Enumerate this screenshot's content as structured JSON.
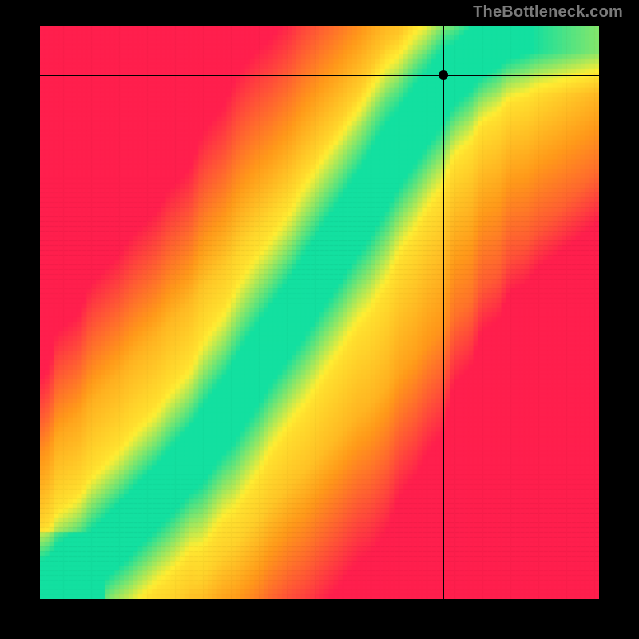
{
  "attribution": "TheBottleneck.com",
  "colors": {
    "red": "#ff1f4d",
    "orange": "#ff9a1a",
    "yellow": "#ffee33",
    "green": "#14e0a0"
  },
  "plot": {
    "crosshair": {
      "x_frac": 0.722,
      "y_frac": 0.087
    },
    "marker": {
      "x_frac": 0.722,
      "y_frac": 0.087
    },
    "ridge": {
      "comment": "Fractional (x,y) points along the green optimal ridge, origin at top-left of plot area. Values estimated from pixels.",
      "points": [
        [
          0.02,
          0.985
        ],
        [
          0.08,
          0.945
        ],
        [
          0.15,
          0.88
        ],
        [
          0.22,
          0.81
        ],
        [
          0.28,
          0.745
        ],
        [
          0.34,
          0.665
        ],
        [
          0.4,
          0.575
        ],
        [
          0.46,
          0.49
        ],
        [
          0.52,
          0.4
        ],
        [
          0.58,
          0.31
        ],
        [
          0.63,
          0.23
        ],
        [
          0.68,
          0.16
        ],
        [
          0.73,
          0.095
        ],
        [
          0.78,
          0.05
        ],
        [
          0.83,
          0.02
        ],
        [
          0.88,
          0.005
        ]
      ],
      "green_half_width_frac": 0.04,
      "yellow_half_width_frac": 0.115
    },
    "pixelation_cells": 120
  },
  "chart_data": {
    "type": "heatmap",
    "title": "",
    "xlabel": "",
    "ylabel": "",
    "xlim": [
      0,
      1
    ],
    "ylim": [
      0,
      1
    ],
    "comment": "No numeric axis labels or titles are visible in the image; only a pixelated heatmap with a crosshair and branding text are rendered.",
    "color_scale": [
      {
        "value": 0.0,
        "color": "#ff1f4d",
        "meaning": "far from optimal"
      },
      {
        "value": 0.4,
        "color": "#ff9a1a",
        "meaning": "suboptimal"
      },
      {
        "value": 0.7,
        "color": "#ffee33",
        "meaning": "near optimal"
      },
      {
        "value": 1.0,
        "color": "#14e0a0",
        "meaning": "optimal"
      }
    ],
    "ridge_points_xy": [
      [
        0.02,
        0.015
      ],
      [
        0.08,
        0.055
      ],
      [
        0.15,
        0.12
      ],
      [
        0.22,
        0.19
      ],
      [
        0.28,
        0.255
      ],
      [
        0.34,
        0.335
      ],
      [
        0.4,
        0.425
      ],
      [
        0.46,
        0.51
      ],
      [
        0.52,
        0.6
      ],
      [
        0.58,
        0.69
      ],
      [
        0.63,
        0.77
      ],
      [
        0.68,
        0.84
      ],
      [
        0.73,
        0.905
      ],
      [
        0.78,
        0.95
      ],
      [
        0.83,
        0.98
      ],
      [
        0.88,
        0.995
      ]
    ],
    "marker_xy": [
      0.722,
      0.913
    ]
  }
}
